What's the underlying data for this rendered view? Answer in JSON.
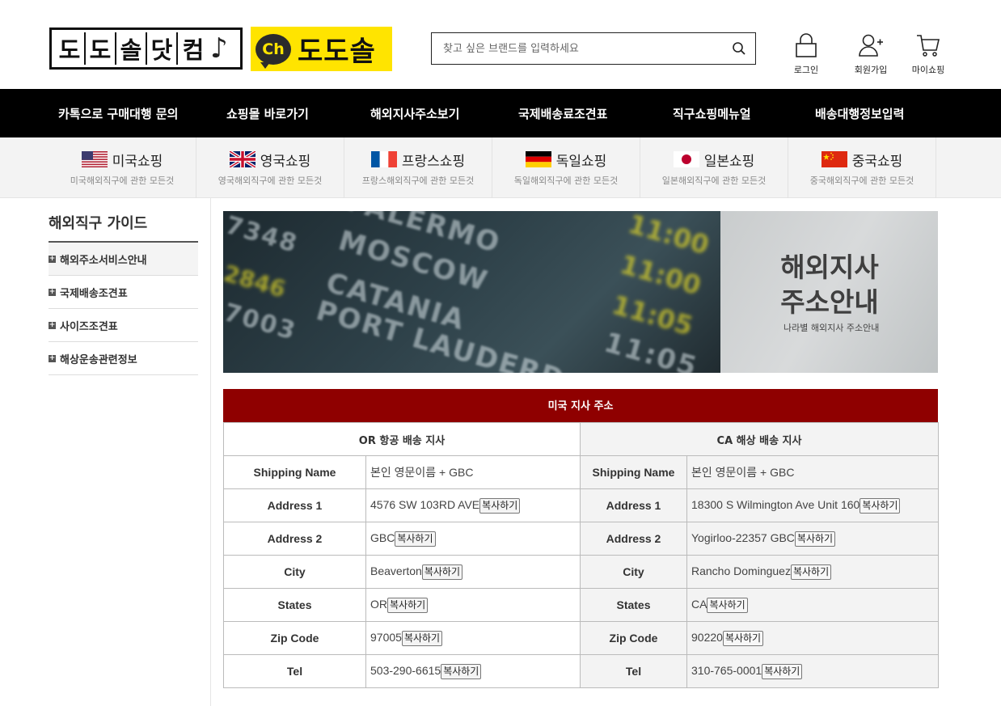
{
  "header": {
    "logo_tiles": [
      "도",
      "도",
      "솔",
      "닷",
      "컴"
    ],
    "logo_note": "♪",
    "ch_badge": "Ch",
    "ch_text": "도도솔",
    "search_placeholder": "찾고 싶은 브랜드를 입력하세요",
    "links": [
      {
        "label": "로그인",
        "icon": "lock-icon"
      },
      {
        "label": "회원가입",
        "icon": "user-add-icon"
      },
      {
        "label": "마이쇼핑",
        "icon": "cart-icon"
      }
    ]
  },
  "main_nav": [
    "카톡으로 구매대행 문의",
    "쇼핑몰 바로가기",
    "해외지사주소보기",
    "국제배송료조견표",
    "직구쇼핑메뉴얼",
    "배송대행정보입력"
  ],
  "country_nav": [
    {
      "name": "미국쇼핑",
      "sub": "미국해외직구에 관한 모든것",
      "flag": "us-flag"
    },
    {
      "name": "영국쇼핑",
      "sub": "영국해외직구에 관한 모든것",
      "flag": "uk-flag"
    },
    {
      "name": "프랑스쇼핑",
      "sub": "프랑스해외직구에 관한 모든것",
      "flag": "fr-flag"
    },
    {
      "name": "독일쇼핑",
      "sub": "독일해외직구에 관한 모든것",
      "flag": "de-flag"
    },
    {
      "name": "일본쇼핑",
      "sub": "일본해외직구에 관한 모든것",
      "flag": "jp-flag"
    },
    {
      "name": "중국쇼핑",
      "sub": "중국해외직구에 관한 모든것",
      "flag": "cn-flag"
    }
  ],
  "sidebar": {
    "title": "해외직구 가이드",
    "items": [
      "해외주소서비스안내",
      "국제배송조견표",
      "사이즈조견표",
      "해상운송관련정보"
    ]
  },
  "banner": {
    "title_line1": "해외지사",
    "title_line2": "주소안내",
    "subtitle": "나라별 해외지사 주소안내",
    "board_words": [
      "PALERMO",
      "MOSCOW",
      "CATANIA",
      "PORT LAUDERD",
      "7348",
      "2846",
      "7003",
      "11:00",
      "11:00",
      "11:05",
      "11:05"
    ]
  },
  "address_table": {
    "caption": "미국 지사 주소",
    "left_header": "OR 항공 배송 지사",
    "right_header": "CA 해상 배송 지사",
    "copy_label": "복사하기",
    "rows": [
      {
        "key": "Shipping Name",
        "left": "본인 영문이름 + GBC",
        "right": "본인 영문이름 + GBC",
        "copy": false
      },
      {
        "key": "Address 1",
        "left": "4576 SW 103RD AVE",
        "right": "18300 S Wilmington Ave Unit 160",
        "copy": true
      },
      {
        "key": "Address 2",
        "left": "GBC",
        "right": "Yogirloo-22357 GBC",
        "copy": true
      },
      {
        "key": "City",
        "left": "Beaverton",
        "right": "Rancho Dominguez",
        "copy": true
      },
      {
        "key": "States",
        "left": "OR",
        "right": "CA",
        "copy": true
      },
      {
        "key": "Zip Code",
        "left": "97005",
        "right": "90220",
        "copy": true
      },
      {
        "key": "Tel",
        "left": "503-290-6615",
        "right": "310-765-0001",
        "copy": true
      }
    ]
  },
  "colors": {
    "nav_bg": "#000000",
    "caption_bg": "#8f0000",
    "ch_logo_bg": "#ffe400"
  }
}
